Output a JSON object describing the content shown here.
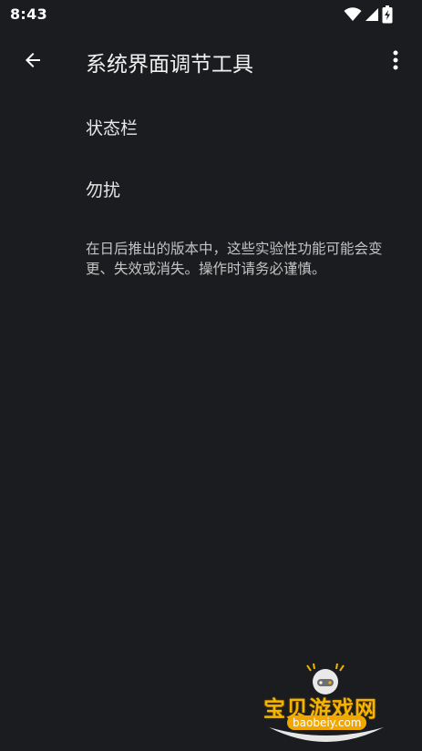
{
  "status_bar": {
    "time": "8:43",
    "icons": [
      "wifi-icon",
      "signal-icon",
      "battery-charging-icon"
    ]
  },
  "app_bar": {
    "title": "系统界面调节工具",
    "back_icon": "arrow-left-icon",
    "more_icon": "more-vertical-icon"
  },
  "items": [
    {
      "label": "状态栏"
    },
    {
      "label": "勿扰"
    }
  ],
  "footer_note": "在日后推出的版本中，这些实验性功能可能会变更、失效或消失。操作时请务必谨慎。",
  "watermark": {
    "title": "宝贝游戏网",
    "url": "baobeiy.com"
  },
  "colors": {
    "background": "#1b1c1f",
    "text_primary": "#e8e8e8",
    "watermark_accent": "#f5b400"
  }
}
